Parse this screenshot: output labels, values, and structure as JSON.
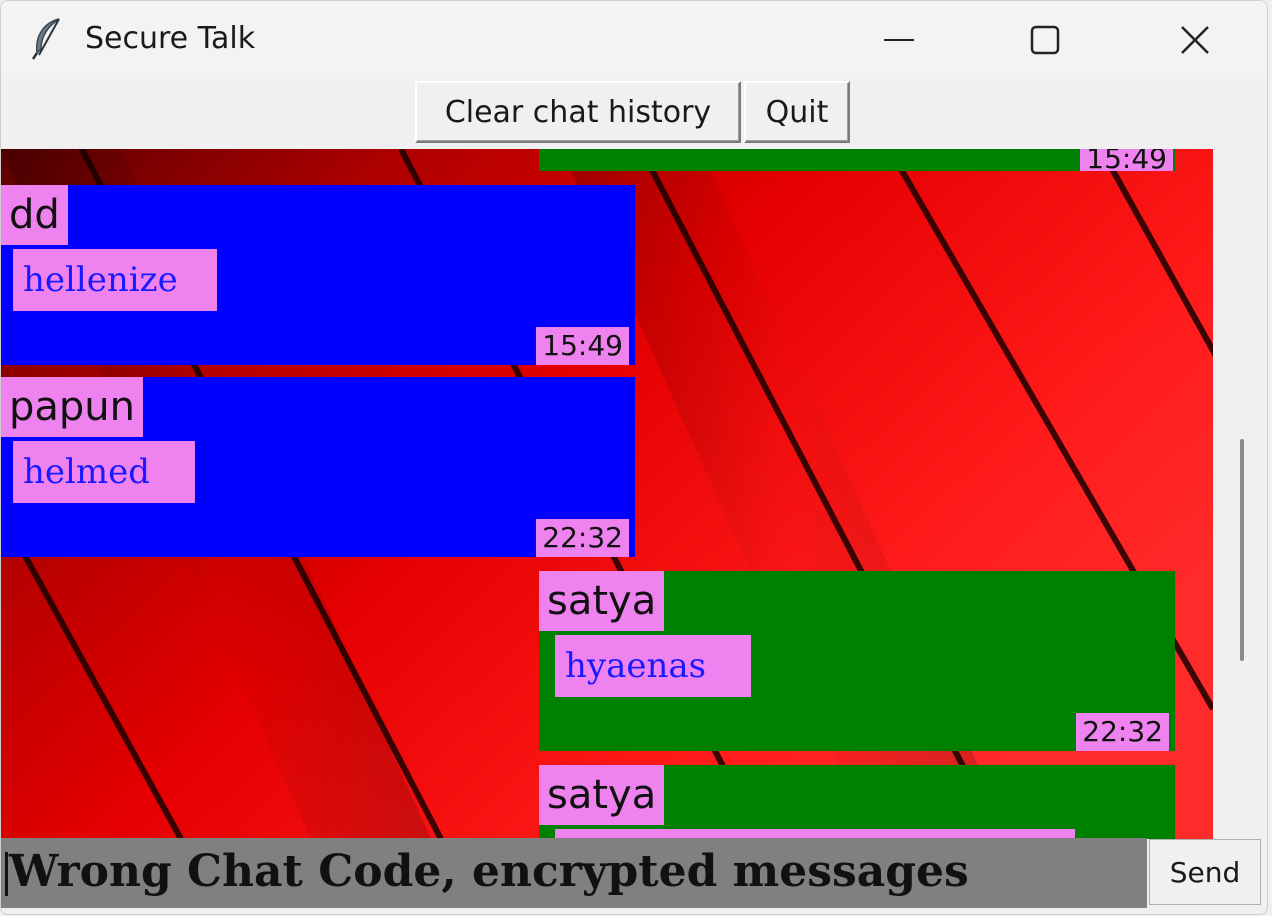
{
  "window": {
    "title": "Secure Talk",
    "icon": "feather-icon",
    "controls": [
      "minimize-icon",
      "maximize-icon",
      "close-icon"
    ]
  },
  "toolbar": {
    "clear_label": "Clear chat history",
    "quit_label": "Quit"
  },
  "colors": {
    "incoming_bubble": "#0000ff",
    "outgoing_bubble": "#008000",
    "label_background": "#ee82ee",
    "message_text": "#1a1aff",
    "chat_background": "#d80000",
    "entry_background": "#808080"
  },
  "messages": [
    {
      "sender": "",
      "text": "",
      "time": "15:49",
      "side": "outgoing"
    },
    {
      "sender": "dd",
      "text": "hellenize",
      "time": "15:49",
      "side": "incoming"
    },
    {
      "sender": "papun",
      "text": "helmed",
      "time": "22:32",
      "side": "incoming"
    },
    {
      "sender": "satya",
      "text": "hyaenas",
      "time": "22:32",
      "side": "outgoing"
    },
    {
      "sender": "satya",
      "text": "",
      "time": "",
      "side": "outgoing"
    }
  ],
  "entry": {
    "value": "Wrong Chat Code, encrypted messages",
    "send_label": "Send"
  }
}
